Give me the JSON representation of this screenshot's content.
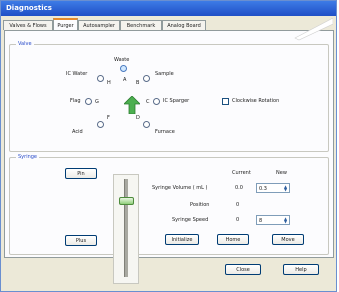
{
  "window": {
    "title": "Diagnostics"
  },
  "tabs": [
    "Valves & Flows",
    "Purger",
    "Autosampler",
    "Benchmark",
    "Analog Board"
  ],
  "active_tab": "Purger",
  "valve": {
    "group_title": "Valve",
    "labels": {
      "waste": "Waste",
      "ic_water": "IC Water",
      "sample": "Sample",
      "flag": "Flag",
      "ic_sparger": "IC Sparger",
      "acid": "Acid",
      "furnace": "Furnace"
    },
    "port_letters": {
      "h": "H",
      "a": "A",
      "b": "B",
      "g": "G",
      "c": "C",
      "f": "F",
      "d": "D"
    },
    "clockwise_rotation_label": "Clockwise Rotation",
    "clockwise_rotation_checked": false
  },
  "syringe": {
    "group_title": "Syringe",
    "pin_button": "Pin",
    "plus_button": "Plus",
    "current_header": "Current",
    "new_header": "New",
    "volume_label": "Syringe Volume ( mL )",
    "volume_current": "0.0",
    "volume_new": "0.3",
    "position_label": "Position",
    "position_current": "0",
    "speed_label": "Syringe Speed",
    "speed_current": "0",
    "speed_new": "8",
    "initialize_button": "Initialize",
    "home_button": "Home",
    "move_button": "Move",
    "slider_level": 0.2
  },
  "footer": {
    "close_button": "Close",
    "help_button": "Help"
  }
}
